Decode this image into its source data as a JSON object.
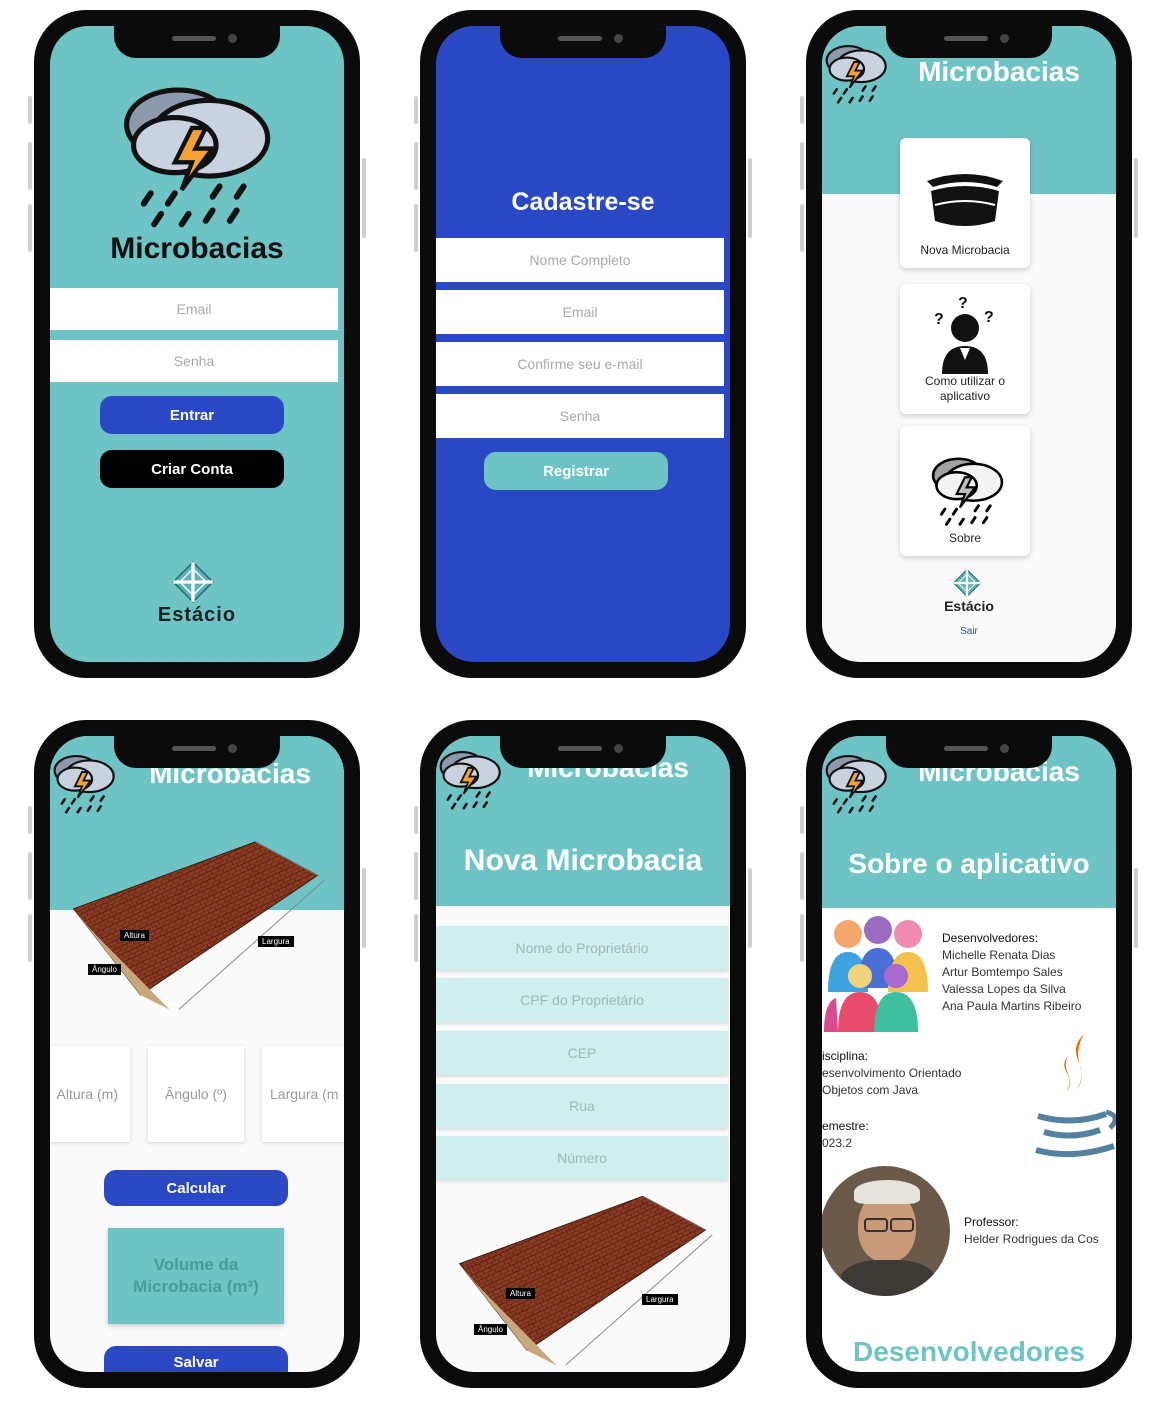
{
  "app_name": "Microbacias",
  "login": {
    "email_placeholder": "Email",
    "password_placeholder": "Senha",
    "enter_label": "Entrar",
    "create_label": "Criar Conta",
    "brand": "Estácio"
  },
  "register": {
    "title": "Cadastre-se",
    "name_placeholder": "Nome Completo",
    "email_placeholder": "Email",
    "confirm_placeholder": "Confirme seu e-mail",
    "password_placeholder": "Senha",
    "register_label": "Registrar"
  },
  "menu": {
    "items": [
      "Nova Microbacia",
      "Como utilizar o aplicativo",
      "Sobre"
    ],
    "brand": "Estácio",
    "logout": "Sair"
  },
  "calc": {
    "diagram_labels": [
      "Altura",
      "Largura",
      "Ângulo"
    ],
    "height_placeholder": "Altura (m)",
    "angle_placeholder": "Ângulo (º)",
    "width_placeholder": "Largura (m",
    "calc_label": "Calcular",
    "volume_label": "Volume da Microbacia (m³)",
    "save_label": "Salvar"
  },
  "new_basin": {
    "title": "Nova Microbacia",
    "fields": [
      "Nome do Proprietário",
      "CPF do Proprietário",
      "CEP",
      "Rua",
      "Número"
    ],
    "diagram_labels": [
      "Altura",
      "Largura",
      "Ângulo"
    ]
  },
  "about": {
    "title": "Sobre o aplicativo",
    "dev_heading": "Desenvolvedores:",
    "devs": [
      "Michelle Renata Dias",
      "Artur Bomtempo Sales",
      "Valessa Lopes da Silva",
      "Ana Paula Martins Ribeiro"
    ],
    "discipline_label": "isciplina:",
    "discipline_lines": [
      "esenvolvimento Orientado",
      "Objetos com Java"
    ],
    "semester_label": "emestre:",
    "semester_value": "023.2",
    "professor_label": "Professor:",
    "professor_name": "Helder Rodrigues da Cos",
    "footer_heading": "Desenvolvedores"
  }
}
